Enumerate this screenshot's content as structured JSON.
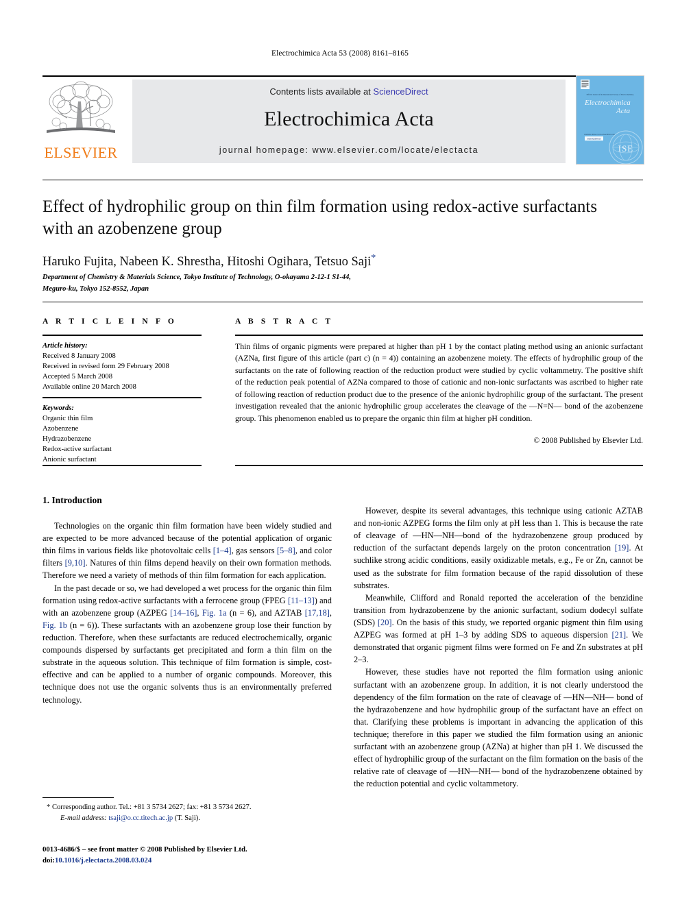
{
  "running_head": "Electrochimica Acta 53 (2008) 8161–8165",
  "masthead": {
    "contents_prefix": "Contents lists available at ",
    "sciencedirect": "ScienceDirect",
    "journal_name": "Electrochimica Acta",
    "homepage": "journal homepage: www.elsevier.com/locate/electacta",
    "publisher_wordmark": "ELSEVIER",
    "cover_line_small": "Official Journal of the International Society of Electrochemistry",
    "cover_title_1": "Electrochimica",
    "cover_title_2": "Acta",
    "cover_badge": "ISE",
    "cover_sciencedirect": "ScienceDirect"
  },
  "article": {
    "title": "Effect of hydrophilic group on thin film formation using redox-active surfactants with an azobenzene group",
    "authors": "Haruko Fujita, Nabeen K. Shrestha, Hitoshi Ogihara, Tetsuo Saji",
    "corresponding_marker": "*",
    "affiliation_line1": "Department of Chemistry & Materials Science, Tokyo Institute of Technology, O-okayama 2-12-1 S1-44,",
    "affiliation_line2": "Meguro-ku, Tokyo 152-8552, Japan"
  },
  "article_info": {
    "heading": "A R T I C L E    I N F O",
    "history_label": "Article history:",
    "history": [
      "Received 8 January 2008",
      "Received in revised form 29 February 2008",
      "Accepted 5 March 2008",
      "Available online 20 March 2008"
    ],
    "keywords_label": "Keywords:",
    "keywords": [
      "Organic thin film",
      "Azobenzene",
      "Hydrazobenzene",
      "Redox-active surfactant",
      "Anionic surfactant"
    ]
  },
  "abstract": {
    "heading": "A B S T R A C T",
    "text": "Thin films of organic pigments were prepared at higher than pH 1 by the contact plating method using an anionic surfactant (AZNa, first figure of this article (part c) (n = 4)) containing an azobenzene moiety. The effects of hydrophilic group of the surfactants on the rate of following reaction of the reduction product were studied by cyclic voltammetry. The positive shift of the reduction peak potential of AZNa compared to those of cationic and non-ionic surfactants was ascribed to higher rate of following reaction of reduction product due to the presence of the anionic hydrophilic group of the surfactant. The present investigation revealed that the anionic hydrophilic group accelerates the cleavage of the —N=N— bond of the azobenzene group. This phenomenon enabled us to prepare the organic thin film at higher pH condition.",
    "copyright": "© 2008 Published by Elsevier Ltd."
  },
  "body": {
    "section_title": "1.  Introduction",
    "left_paragraphs": [
      "Technologies on the organic thin film formation have been widely studied and are expected to be more advanced because of the potential application of organic thin films in various fields like photovoltaic cells [1–4], gas sensors [5–8], and color filters [9,10]. Natures of thin films depend heavily on their own formation methods. Therefore we need a variety of methods of thin film formation for each application.",
      "In the past decade or so, we had developed a wet process for the organic thin film formation using redox-active surfactants with a ferrocene group (FPEG [11–13]) and with an azobenzene group (AZPEG [14–16], Fig. 1a (n = 6), and AZTAB [17,18], Fig. 1b (n = 6)). These surfactants with an azobenzene group lose their function by reduction. Therefore, when these surfactants are reduced electrochemically, organic compounds dispersed by surfactants get precipitated and form a thin film on the substrate in the aqueous solution. This technique of film formation is simple, cost-effective and can be applied to a number of organic compounds. Moreover, this technique does not use the organic solvents thus is an environmentally preferred technology."
    ],
    "right_paragraphs": [
      "However, despite its several advantages, this technique using cationic AZTAB and non-ionic AZPEG forms the film only at pH less than 1. This is because the rate of cleavage of —HN—NH—bond of the hydrazobenzene group produced by reduction of the surfactant depends largely on the proton concentration [19]. At suchlike strong acidic conditions, easily oxidizable metals, e.g., Fe or Zn, cannot be used as the substrate for film formation because of the rapid dissolution of these substrates.",
      "Meanwhile, Clifford and Ronald reported the acceleration of the benzidine transition from hydrazobenzene by the anionic surfactant, sodium dodecyl sulfate (SDS) [20]. On the basis of this study, we reported organic pigment thin film using AZPEG was formed at pH 1–3 by adding SDS to aqueous dispersion [21]. We demonstrated that organic pigment films were formed on Fe and Zn substrates at pH 2–3.",
      "However, these studies have not reported the film formation using anionic surfactant with an azobenzene group. In addition, it is not clearly understood the dependency of the film formation on the rate of cleavage of —HN—NH— bond of the hydrazobenzene and how hydrophilic group of the surfactant have an effect on that. Clarifying these problems is important in advancing the application of this technique; therefore in this paper we studied the film formation using an anionic surfactant with an azobenzene group (AZNa) at higher than pH 1. We discussed the effect of hydrophilic group of the surfactant on the film formation on the basis of the relative rate of cleavage of —HN—NH— bond of the hydrazobenzene obtained by the reduction potential and cyclic voltammetory."
    ]
  },
  "footnotes": {
    "corresponding": "* Corresponding author. Tel.: +81 3 5734 2627; fax: +81 3 5734 2627.",
    "email_label": "E-mail address:",
    "email": "tsaji@o.cc.titech.ac.jp",
    "email_suffix": "(T. Saji).",
    "imprint": "0013-4686/$ – see front matter © 2008 Published by Elsevier Ltd.",
    "doi_label": "doi:",
    "doi": "10.1016/j.electacta.2008.03.024"
  },
  "colors": {
    "link_blue": "#1b3a8f",
    "sciencedirect_blue": "#3b3bb0",
    "elsevier_orange": "#f07d1a",
    "band_grey": "#e7e8ea",
    "cover_blue": "#6cb6e4"
  }
}
